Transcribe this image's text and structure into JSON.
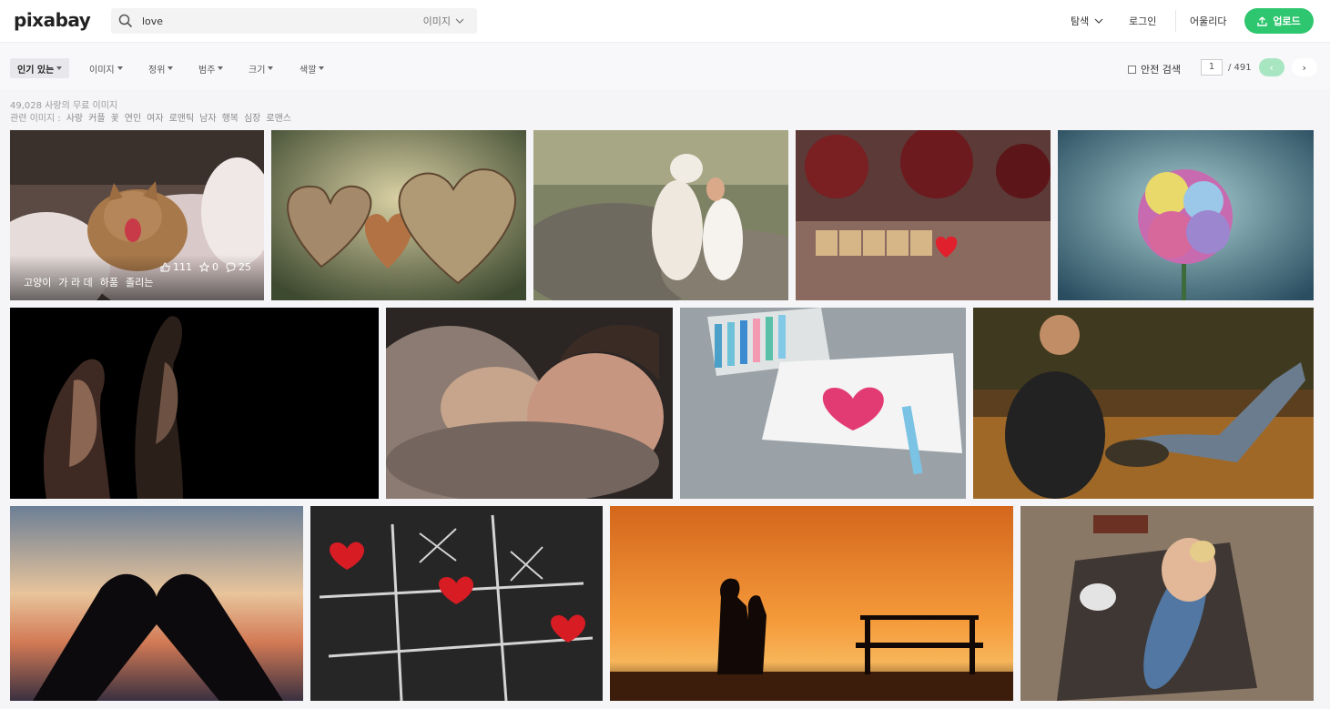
{
  "header": {
    "logo": "pixabay",
    "search_value": "love",
    "search_type": "이미지",
    "explore_label": "탐색",
    "login_label": "로그인",
    "join_label": "어울리다",
    "upload_label": "업로드",
    "accent_color": "#2ec66e"
  },
  "filters": {
    "popular": "인기 있는",
    "type": "이미지",
    "orientation": "정위",
    "category": "범주",
    "size": "크기",
    "color": "색깔",
    "safe_search": "안전 검색"
  },
  "pager": {
    "current_page": "1",
    "total": "/ 491",
    "prev": "‹",
    "next": "›"
  },
  "results": {
    "count_text": "49,028 사랑의 무료 이미지",
    "related_label": "관련 이미지 :",
    "related_tags": [
      "사랑",
      "커플",
      "꽃",
      "연인",
      "여자",
      "로맨틱",
      "남자",
      "행복",
      "심장",
      "로맨스"
    ]
  },
  "photos": [
    {
      "name": "cat-yawning-in-bed",
      "likes": "111",
      "favorites": "0",
      "comments": "25",
      "tags": [
        "고양이",
        "가 라 데",
        "하품",
        "졸리는"
      ]
    },
    {
      "name": "wooden-hearts"
    },
    {
      "name": "white-tiger-and-woman"
    },
    {
      "name": "love-scrabble-tiles"
    },
    {
      "name": "rainbow-rose"
    },
    {
      "name": "couple-silhouette-profile"
    },
    {
      "name": "father-and-baby-sleeping"
    },
    {
      "name": "crayon-heart-card"
    },
    {
      "name": "couple-in-field"
    },
    {
      "name": "hand-heart-sunset"
    },
    {
      "name": "tic-tac-toe-hearts"
    },
    {
      "name": "couple-kissing-sunset"
    },
    {
      "name": "couple-on-blanket"
    }
  ]
}
